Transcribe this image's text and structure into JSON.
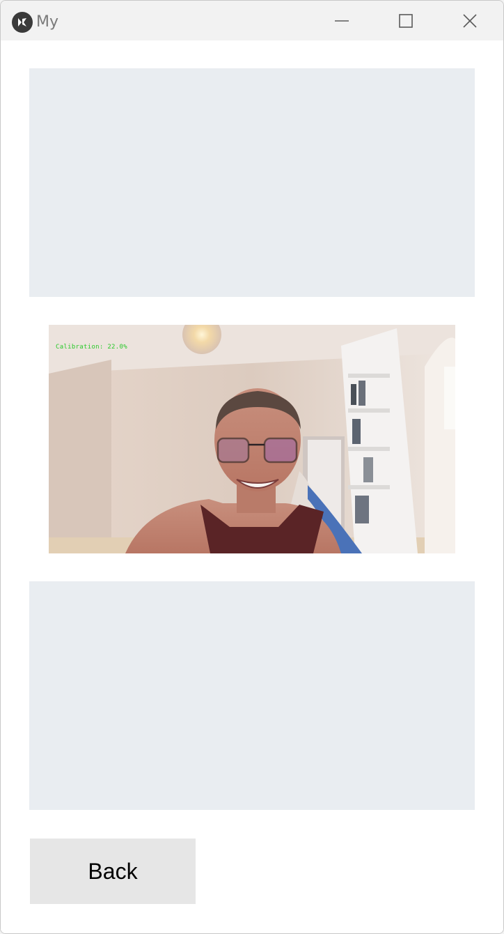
{
  "window": {
    "title": "My",
    "controls": {
      "minimize": "minimize",
      "maximize": "maximize",
      "close": "close"
    }
  },
  "camera_feed": {
    "overlay_text": "Calibration: 22.0%",
    "overlay_color": "#29c929",
    "calibration_progress_percent": 22.0
  },
  "buttons": {
    "back_label": "Back"
  },
  "colors": {
    "panel_background": "#e9edf1",
    "button_background": "#e6e6e6",
    "titlebar_background": "#f2f2f2"
  }
}
